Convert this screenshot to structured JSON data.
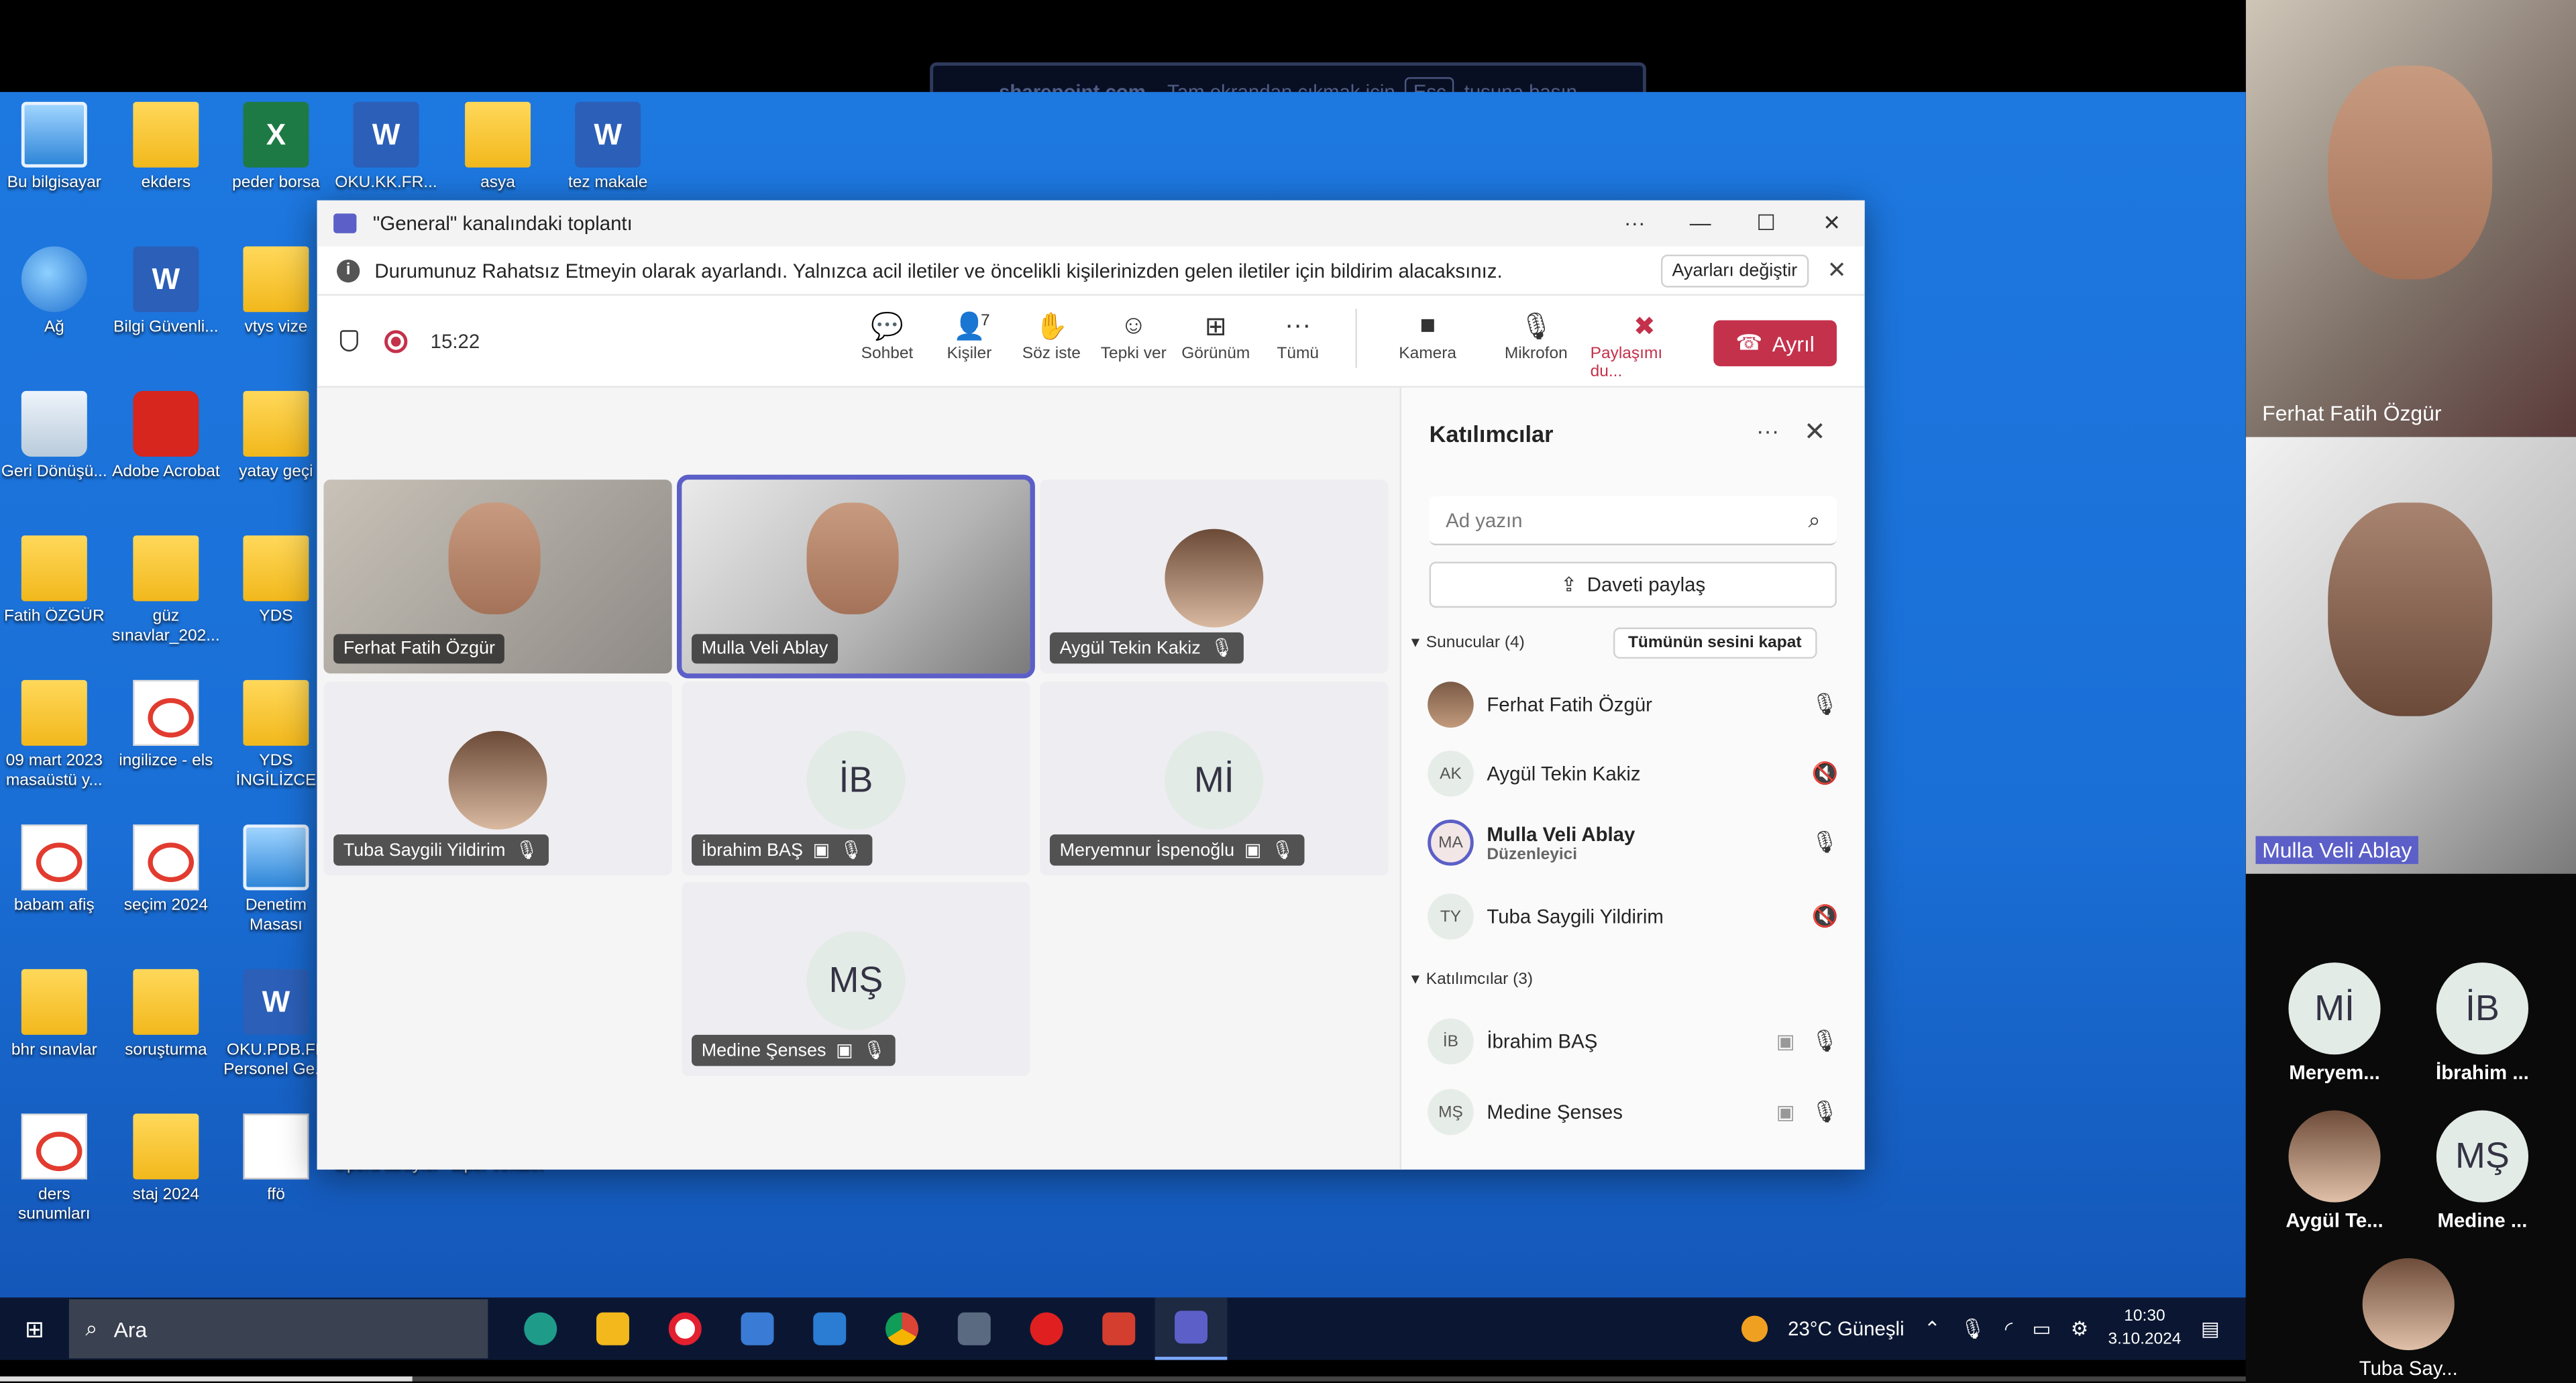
{
  "fullscreen_hint": {
    "host": "sharepoint.com",
    "pre": " - Tam ekrandan çıkmak için",
    "key": "Esc",
    "post": "tuşuna basın"
  },
  "desktop_icons": [
    {
      "label": "Bu bilgisayar",
      "icon": "computer-icon"
    },
    {
      "label": "ekders",
      "icon": "folder-icon"
    },
    {
      "label": "peder borsa",
      "icon": "excel-icon"
    },
    {
      "label": "OKU.KK.FR...",
      "icon": "word-icon"
    },
    {
      "label": "asya",
      "icon": "image-icon"
    },
    {
      "label": "tez makale",
      "icon": "word-icon"
    },
    {
      "label": "Ağ",
      "icon": "network-icon"
    },
    {
      "label": "Bilgi Güvenli...",
      "icon": "word-icon"
    },
    {
      "label": "vtys vize",
      "icon": "folder-icon"
    },
    {
      "label": "Geri Dönüşü...",
      "icon": "recycle-bin-icon"
    },
    {
      "label": "Adobe Acrobat",
      "icon": "acrobat-icon"
    },
    {
      "label": "yatay geçi",
      "icon": "folder-icon"
    },
    {
      "label": "Fatih ÖZGÜR",
      "icon": "user-folder-icon"
    },
    {
      "label": "güz sınavlar_202...",
      "icon": "folder-icon"
    },
    {
      "label": "YDS",
      "icon": "folder-icon"
    },
    {
      "label": "09 mart 2023 masaüstü y...",
      "icon": "folder-icon"
    },
    {
      "label": "ingilizce - els",
      "icon": "pdf-icon"
    },
    {
      "label": "YDS İNGİLİZCE",
      "icon": "folder-icon"
    },
    {
      "label": "babam afiş",
      "icon": "pdf-icon"
    },
    {
      "label": "seçim 2024",
      "icon": "pdf-icon"
    },
    {
      "label": "Denetim Masası",
      "icon": "control-panel-icon"
    },
    {
      "label": "bhr sınavlar",
      "icon": "folder-icon"
    },
    {
      "label": "soruşturma",
      "icon": "folder-icon"
    },
    {
      "label": "OKU.PDB.FF Personel Ge...",
      "icon": "word-icon"
    },
    {
      "label": "ders sunumları",
      "icon": "pdf-icon"
    },
    {
      "label": "staj 2024",
      "icon": "folder-icon"
    },
    {
      "label": "ffö",
      "icon": "photo-icon"
    },
    {
      "label": "Opera tarayıcı",
      "icon": "opera-icon"
    },
    {
      "label": "alper vekalet",
      "icon": "pdf-icon"
    }
  ],
  "window": {
    "title": "\"General\" kanalındaki toplantı",
    "controls": {
      "more": "···",
      "minimize": "—",
      "maximize": "☐",
      "close": "✕"
    },
    "notice": {
      "text": "Durumunuz Rahatsız Etmeyin olarak ayarlandı. Yalnızca acil iletiler ve öncelikli kişilerinizden gelen iletiler için bildirim alacaksınız.",
      "button": "Ayarları değiştir",
      "close": "✕"
    },
    "timer": "15:22",
    "toolbar": [
      {
        "label": "Sohbet",
        "icon": "chat-icon",
        "glyph": "💬"
      },
      {
        "label": "Kişiler",
        "icon": "people-icon",
        "glyph": "👤",
        "count": "7",
        "active": true
      },
      {
        "label": "Söz iste",
        "icon": "raise-hand-icon",
        "glyph": "✋"
      },
      {
        "label": "Tepki ver",
        "icon": "reaction-icon",
        "glyph": "☺"
      },
      {
        "label": "Görünüm",
        "icon": "view-icon",
        "glyph": "⊞"
      },
      {
        "label": "Tümü",
        "icon": "more-icon",
        "glyph": "···"
      },
      {
        "label": "Kamera",
        "icon": "camera-icon",
        "glyph": "■"
      },
      {
        "label": "Mikrofon",
        "icon": "mic-icon",
        "glyph": "🎙"
      },
      {
        "label": "Paylaşımı du...",
        "icon": "stop-share-icon",
        "glyph": "✖"
      }
    ],
    "leave_label": "Ayrıl"
  },
  "tiles": [
    {
      "name": "Ferhat Fatih Özgür",
      "type": "video"
    },
    {
      "name": "Mulla Veli Ablay",
      "type": "video",
      "active": true
    },
    {
      "name": "Aygül Tekin Kakiz",
      "type": "photo",
      "muted": true
    },
    {
      "name": "Tuba Saygili Yildirim",
      "type": "photo",
      "muted": true
    },
    {
      "name": "İbrahim BAŞ",
      "type": "initials",
      "initials": "İB"
    },
    {
      "name": "Meryemnur İspenoğlu",
      "type": "initials",
      "initials": "Mİ"
    },
    {
      "name": "Medine Şenses",
      "type": "initials",
      "initials": "MŞ"
    }
  ],
  "participants_panel": {
    "title": "Katılımcılar",
    "search_placeholder": "Ad yazın",
    "invite_label": "Daveti paylaş",
    "presenters_label": "Sunucular (4)",
    "mute_all": "Tümünün sesini kapat",
    "presenters": [
      {
        "name": "Ferhat Fatih Özgür",
        "avatar": "photo",
        "mic": "on"
      },
      {
        "name": "Aygül Tekin Kakiz",
        "avatar": "AK",
        "mic": "off"
      },
      {
        "name": "Mulla Veli Ablay",
        "avatar": "MA",
        "sub": "Düzenleyici",
        "mic": "on"
      },
      {
        "name": "Tuba Saygili Yildirim",
        "avatar": "TY",
        "mic": "off"
      }
    ],
    "attendees_label": "Katılımcılar (3)",
    "attendees": [
      {
        "name": "İbrahim BAŞ",
        "avatar": "İB"
      },
      {
        "name": "Medine Şenses",
        "avatar": "MŞ"
      }
    ]
  },
  "taskbar": {
    "search": "Ara",
    "weather": "23°C Güneşli",
    "time": "10:30",
    "date": "3.10.2024"
  },
  "right_panel": {
    "videos": [
      {
        "name": "Ferhat Fatih Özgür"
      },
      {
        "name": "Mulla Veli Ablay"
      }
    ],
    "grid": [
      {
        "name": "Meryem...",
        "initials": "Mİ"
      },
      {
        "name": "İbrahim ...",
        "initials": "İB"
      },
      {
        "name": "Aygül Te...",
        "initials": ""
      },
      {
        "name": "Medine ...",
        "initials": "MŞ"
      },
      {
        "name": "Tuba Say...",
        "initials": ""
      }
    ]
  },
  "progress": 0.16
}
